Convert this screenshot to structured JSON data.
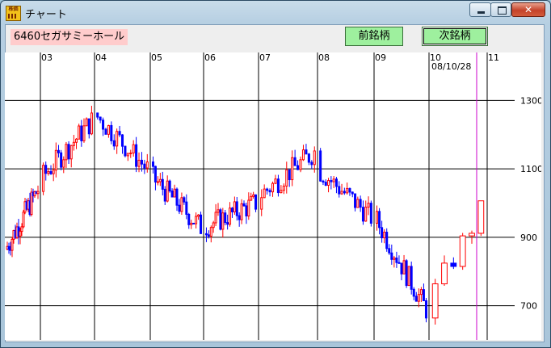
{
  "window": {
    "title": "チャート",
    "app_icon_label": "株価",
    "controls": {
      "minimize": "minimize",
      "maximize": "maximize",
      "close": "✕"
    }
  },
  "toolbar": {
    "stock_name": "6460セガサミーホール",
    "prev_button": "前銘柄",
    "next_button": "次銘柄"
  },
  "chart_data": {
    "type": "candlestick",
    "month_labels": [
      "03",
      "04",
      "05",
      "06",
      "07",
      "08",
      "09",
      "10",
      "11"
    ],
    "date_label": "08/10/28",
    "y_ticks": [
      700,
      900,
      1100,
      1300
    ],
    "ylim": [
      600,
      1440
    ],
    "grid": true,
    "colors": {
      "up": "#ff0000",
      "down": "#0000ff",
      "cursor": "#cc00cc",
      "grid": "#000000",
      "background": "#ffffff"
    },
    "series": [
      {
        "name": "Mar",
        "start": 865,
        "end": 1040,
        "days": 20
      },
      {
        "name": "Apr",
        "start": 1070,
        "end": 1240,
        "days": 20
      },
      {
        "name": "May",
        "start": 1260,
        "end": 1100,
        "days": 19
      },
      {
        "name": "Jun",
        "start": 1080,
        "end": 930,
        "days": 21
      },
      {
        "name": "Jul",
        "start": 930,
        "end": 1000,
        "days": 22
      },
      {
        "name": "Aug",
        "start": 1020,
        "end": 1150,
        "days": 20
      },
      {
        "name": "Sep",
        "start": 1100,
        "end": 960,
        "days": 20
      },
      {
        "name": "Oct",
        "start": 960,
        "end": 690,
        "days": 21
      },
      {
        "name": "Nov",
        "start": 700,
        "end": 975,
        "days": 6
      }
    ]
  }
}
